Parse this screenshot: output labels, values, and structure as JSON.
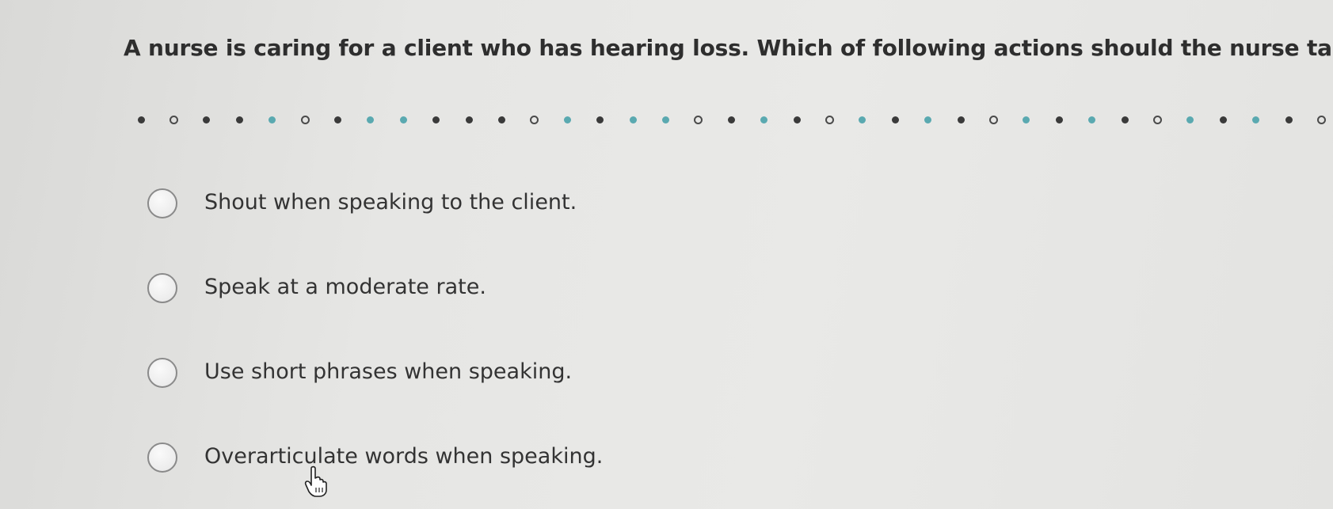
{
  "question": {
    "text": "A nurse is caring for a client who has hearing loss. Which of following actions should the nurse take?"
  },
  "progress": {
    "dots": [
      "dark",
      "hollow",
      "dark",
      "dark",
      "teal",
      "hollow",
      "dark",
      "teal",
      "teal",
      "dark",
      "dark",
      "dark",
      "hollow",
      "teal",
      "dark",
      "teal",
      "teal",
      "hollow",
      "dark",
      "teal",
      "dark",
      "hollow",
      "teal",
      "dark",
      "teal",
      "dark",
      "hollow",
      "teal",
      "dark",
      "teal",
      "dark",
      "hollow",
      "teal",
      "dark",
      "teal",
      "dark",
      "hollow"
    ],
    "colors": {
      "dark": "#3a3a3a",
      "teal": "#5aa9b0",
      "hollow": "#4a4a4a"
    }
  },
  "options": [
    {
      "label": "Shout when speaking to the client.",
      "selected": false
    },
    {
      "label": "Speak at a moderate rate.",
      "selected": false
    },
    {
      "label": "Use short phrases when speaking.",
      "selected": false
    },
    {
      "label": "Overarticulate words when speaking.",
      "selected": false
    }
  ],
  "cursor": {
    "icon": "hand-pointer-icon"
  }
}
